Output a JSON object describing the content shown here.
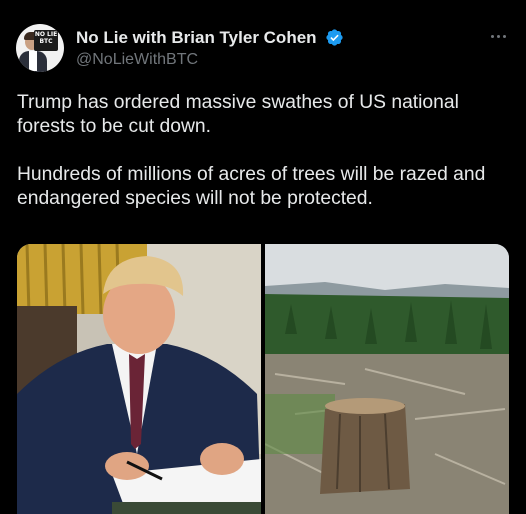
{
  "author": {
    "name": "No Lie with Brian Tyler Cohen",
    "handle": "@NoLieWithBTC",
    "avatar_badge": "NO LIE BTC",
    "verified_color": "#1d9bf0"
  },
  "post": {
    "paragraph_1": "Trump has ordered massive swathes of US national forests to be cut down.",
    "paragraph_2": "Hundreds of millions of acres of trees will be razed and endangered species will not be protected."
  },
  "icons": {
    "more": "more-options-icon",
    "verified": "verified-badge-icon"
  }
}
